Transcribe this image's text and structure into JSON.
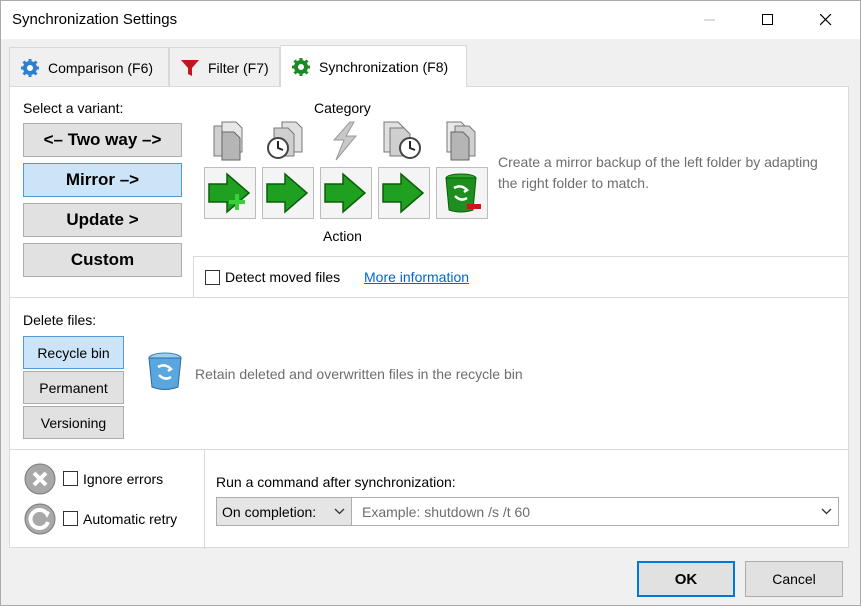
{
  "window": {
    "title": "Synchronization Settings",
    "controls": [
      "minimize",
      "maximize",
      "close"
    ]
  },
  "tabs": [
    {
      "label": "Comparison (F6)",
      "icon": "gear-icon"
    },
    {
      "label": "Filter (F7)",
      "icon": "funnel-icon"
    },
    {
      "label": "Synchronization (F8)",
      "icon": "sync-gear-icon",
      "active": true
    }
  ],
  "variant": {
    "label": "Select a variant:",
    "buttons": [
      {
        "label": "<– Two way –>"
      },
      {
        "label": "Mirror –>",
        "selected": true
      },
      {
        "label": "Update >"
      },
      {
        "label": "Custom"
      }
    ]
  },
  "category": {
    "label": "Category",
    "icons": [
      "file-left-only-icon",
      "file-left-newer-icon",
      "file-different-icon",
      "file-right-newer-icon",
      "file-right-only-icon"
    ]
  },
  "action": {
    "label": "Action",
    "icons": [
      "create-right-icon",
      "overwrite-right-icon",
      "overwrite-right-icon",
      "overwrite-right-icon",
      "delete-right-icon"
    ]
  },
  "description": "Create a mirror backup of the left folder by adapting the right folder to match.",
  "detect_moved": {
    "label": "Detect moved files",
    "checked": false,
    "link": "More information"
  },
  "delete_files": {
    "label": "Delete files:",
    "options": [
      {
        "label": "Recycle bin",
        "selected": true
      },
      {
        "label": "Permanent"
      },
      {
        "label": "Versioning"
      }
    ],
    "description": "Retain deleted and overwritten files in the recycle bin"
  },
  "errors": {
    "ignore_label": "Ignore errors",
    "retry_label": "Automatic retry"
  },
  "command": {
    "label": "Run a command after synchronization:",
    "when": "On completion:",
    "placeholder": "Example: shutdown /s /t 60"
  },
  "footer": {
    "ok": "OK",
    "cancel": "Cancel"
  },
  "colors": {
    "accent": "#0078d7",
    "selected_bg": "#cce4f7",
    "green": "#1f9a1f",
    "link": "#0066cc"
  }
}
